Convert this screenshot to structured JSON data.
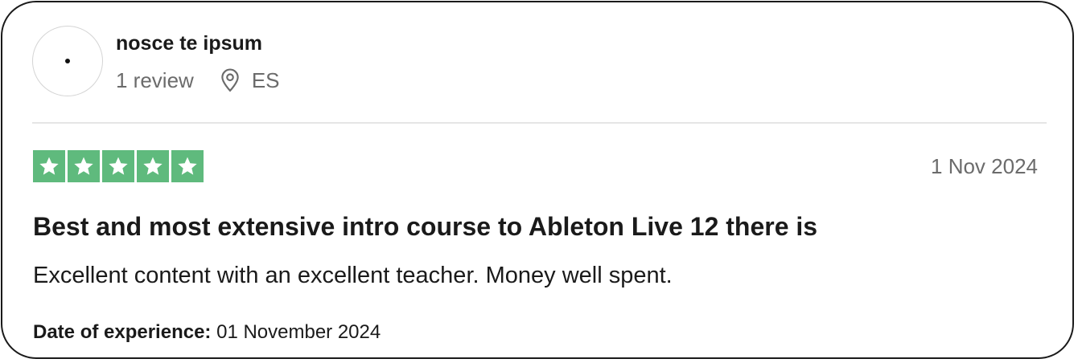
{
  "reviewer": {
    "name": "nosce te ipsum",
    "review_count": "1 review",
    "location_icon": "map-pin-icon",
    "country": "ES"
  },
  "rating": {
    "stars": 5,
    "max_stars": 5,
    "star_color": "#5fba7d",
    "star_icon": "star-icon"
  },
  "review": {
    "date": "1 Nov 2024",
    "title": "Best and most extensive intro course to Ableton Live 12 there is",
    "text": "Excellent content with an excellent teacher. Money well spent.",
    "experience_label": "Date of experience:",
    "experience_date": "01 November 2024"
  }
}
